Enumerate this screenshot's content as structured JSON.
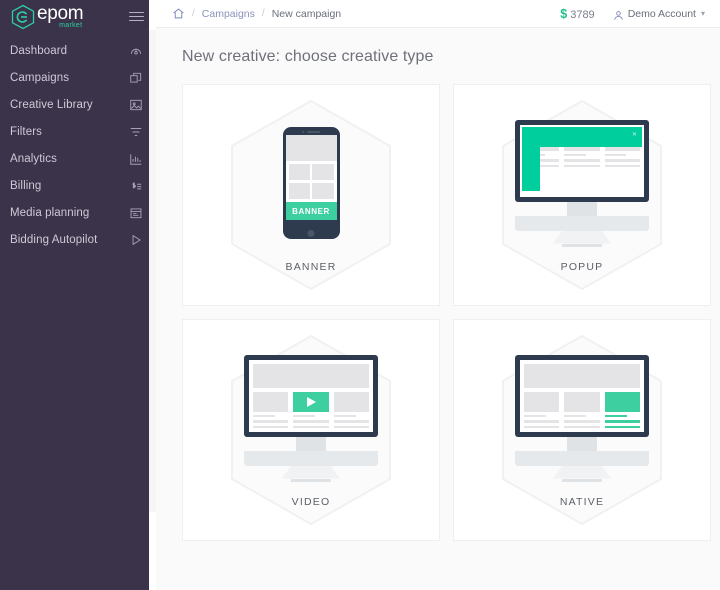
{
  "sidebar": {
    "logo": {
      "name": "epom",
      "sub": "market",
      "mark": "hexagon-e-icon"
    },
    "menu_toggle": "hamburger-icon",
    "items": [
      {
        "label": "Dashboard",
        "icon": "gauge-icon"
      },
      {
        "label": "Campaigns",
        "icon": "layers-icon"
      },
      {
        "label": "Creative Library",
        "icon": "image-icon"
      },
      {
        "label": "Filters",
        "icon": "filter-icon"
      },
      {
        "label": "Analytics",
        "icon": "bar-chart-icon"
      },
      {
        "label": "Billing",
        "icon": "dollar-list-icon"
      },
      {
        "label": "Media planning",
        "icon": "calendar-icon"
      },
      {
        "label": "Bidding Autopilot",
        "icon": "play-icon"
      }
    ]
  },
  "topbar": {
    "home_icon": "home-icon",
    "separator": "/",
    "breadcrumb": [
      {
        "label": "Campaigns",
        "current": false
      },
      {
        "label": "New campaign",
        "current": true
      }
    ],
    "balance": {
      "symbol": "$",
      "value": "3789"
    },
    "account": {
      "icon": "user-icon",
      "name": "Demo Account",
      "caret": "▾"
    }
  },
  "main": {
    "title": "New creative: choose creative type",
    "cards": [
      {
        "label": "BANNER",
        "art": "phone-banner-art"
      },
      {
        "label": "POPUP",
        "art": "monitor-popup-art"
      },
      {
        "label": "VIDEO",
        "art": "monitor-video-art"
      },
      {
        "label": "NATIVE",
        "art": "monitor-native-art"
      }
    ],
    "banner_art": {
      "badge_text": "BANNER"
    },
    "popup_art": {
      "close_mark": "✕"
    }
  },
  "colors": {
    "sidebar_bg": "#3b3349",
    "accent_teal": "#3ecfa0",
    "popup_teal": "#00cf9d",
    "device_dark": "#2e3a4d",
    "balance_green": "#23c08b",
    "link_blue": "#8a93bb"
  }
}
